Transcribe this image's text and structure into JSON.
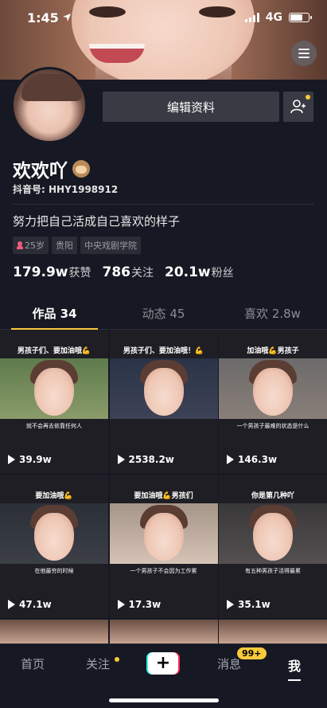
{
  "status_bar": {
    "time": "1:45",
    "network": "4G"
  },
  "profile": {
    "edit_label": "编辑资料",
    "name": "欢欢吖",
    "douyin_id": "抖音号: HHY1998912",
    "bio": "努力把自己活成自己喜欢的样子",
    "tags": [
      "25岁",
      "贵阳",
      "中央戏剧学院"
    ],
    "stats": [
      {
        "value": "179.9w",
        "label": "获赞"
      },
      {
        "value": "786",
        "label": "关注"
      },
      {
        "value": "20.1w",
        "label": "粉丝"
      }
    ]
  },
  "tabs": [
    {
      "label": "作品 34"
    },
    {
      "label": "动态 45"
    },
    {
      "label": "喜欢 2.8w"
    }
  ],
  "videos": [
    {
      "title": "男孩子们、要加油哦💪",
      "caption": "就不会再去依靠任何人",
      "views": "39.9w"
    },
    {
      "title": "男孩子们、要加油哦！💪",
      "caption": "",
      "views": "2538.2w"
    },
    {
      "title": "加油哦💪男孩子",
      "caption": "一个男孩子最难的状态是什么",
      "views": "146.3w"
    },
    {
      "title": "要加油哦💪",
      "caption": "在他最穷的时候",
      "views": "47.1w"
    },
    {
      "title": "要加油哦💪男孩们",
      "caption": "一个男孩子不会因为工作累",
      "views": "17.3w"
    },
    {
      "title": "你是第几种吖",
      "caption": "有五种男孩子活得最累",
      "views": "35.1w"
    }
  ],
  "nav": {
    "home": "首页",
    "follow": "关注",
    "plus": "+",
    "messages": "消息",
    "messages_badge": "99+",
    "me": "我"
  }
}
